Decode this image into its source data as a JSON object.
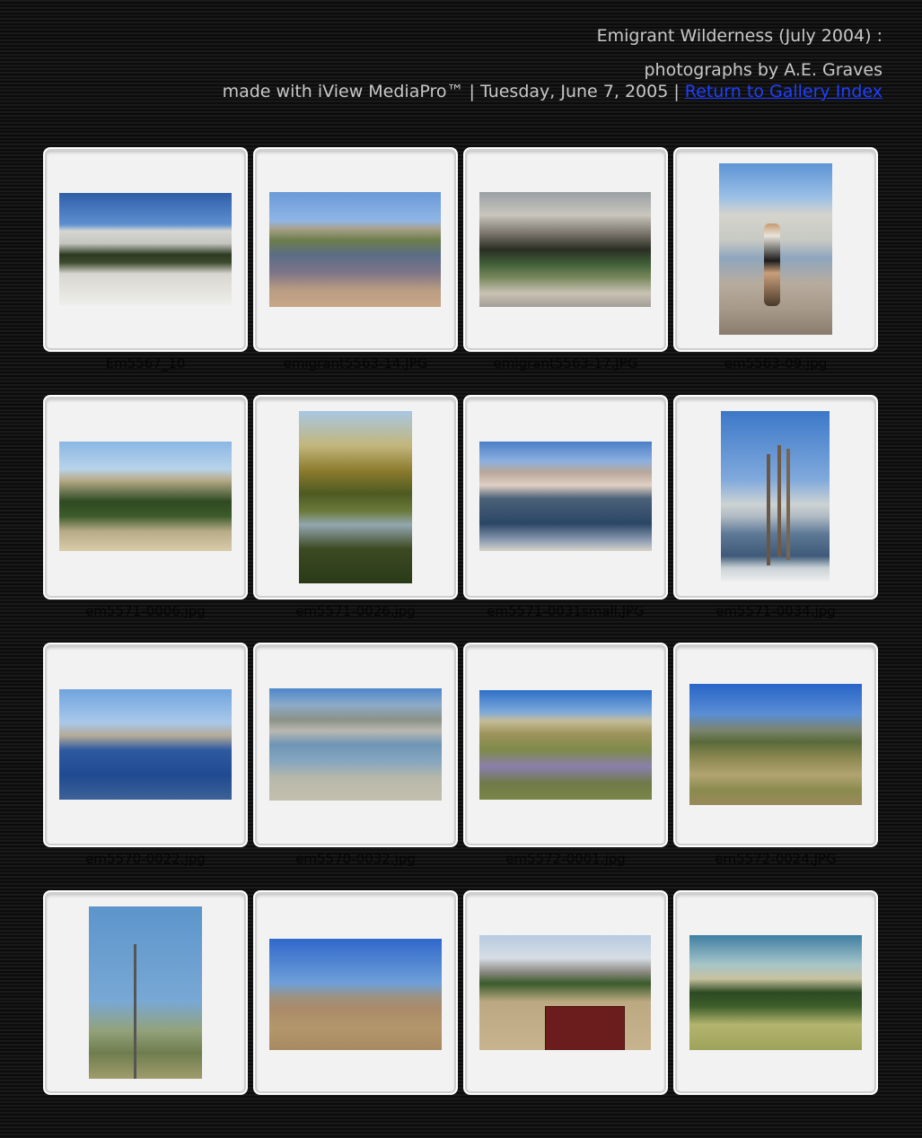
{
  "header": {
    "title": "Emigrant Wilderness (July 2004) :",
    "byline": "photographs by A.E. Graves",
    "meta_prefix": "made with iView MediaPro™ | Tuesday, June 7, 2005 | ",
    "return_link": "Return to Gallery Index"
  },
  "gallery": {
    "items": [
      {
        "caption": "Em5567_10",
        "scene": "granite-mountains",
        "orientation": "landscape"
      },
      {
        "caption": "emigrant5563-14.JPG",
        "scene": "rocky-pond",
        "orientation": "landscape"
      },
      {
        "caption": "emigrant5563-17.JPG",
        "scene": "granite-pool",
        "orientation": "landscape"
      },
      {
        "caption": "em5563-09.jpg",
        "scene": "hiker-on-granite",
        "orientation": "portrait"
      },
      {
        "caption": "em5571-0006.jpg",
        "scene": "lake-with-forest",
        "orientation": "landscape"
      },
      {
        "caption": "em5571-0026.jpg",
        "scene": "trees-reflection",
        "orientation": "portrait"
      },
      {
        "caption": "em5571-0031small.JPG",
        "scene": "granite-lake",
        "orientation": "landscape"
      },
      {
        "caption": "em5571-0034.jpg",
        "scene": "snags-in-lake",
        "orientation": "portrait"
      },
      {
        "caption": "em5570-0022.jpg",
        "scene": "blue-lake",
        "orientation": "landscape"
      },
      {
        "caption": "em5570-0032.jpg",
        "scene": "lake-shore",
        "orientation": "landscape"
      },
      {
        "caption": "em5572-0001.jpg",
        "scene": "lupine-meadow",
        "orientation": "landscape"
      },
      {
        "caption": "em5572-0024.JPG",
        "scene": "grassy-hill",
        "orientation": "landscape"
      },
      {
        "caption": "",
        "scene": "tower-on-hill",
        "orientation": "portrait"
      },
      {
        "caption": "",
        "scene": "dry-field",
        "orientation": "landscape"
      },
      {
        "caption": "",
        "scene": "wilderness-sign",
        "orientation": "landscape"
      },
      {
        "caption": "",
        "scene": "forest-meadow",
        "orientation": "landscape"
      }
    ]
  }
}
